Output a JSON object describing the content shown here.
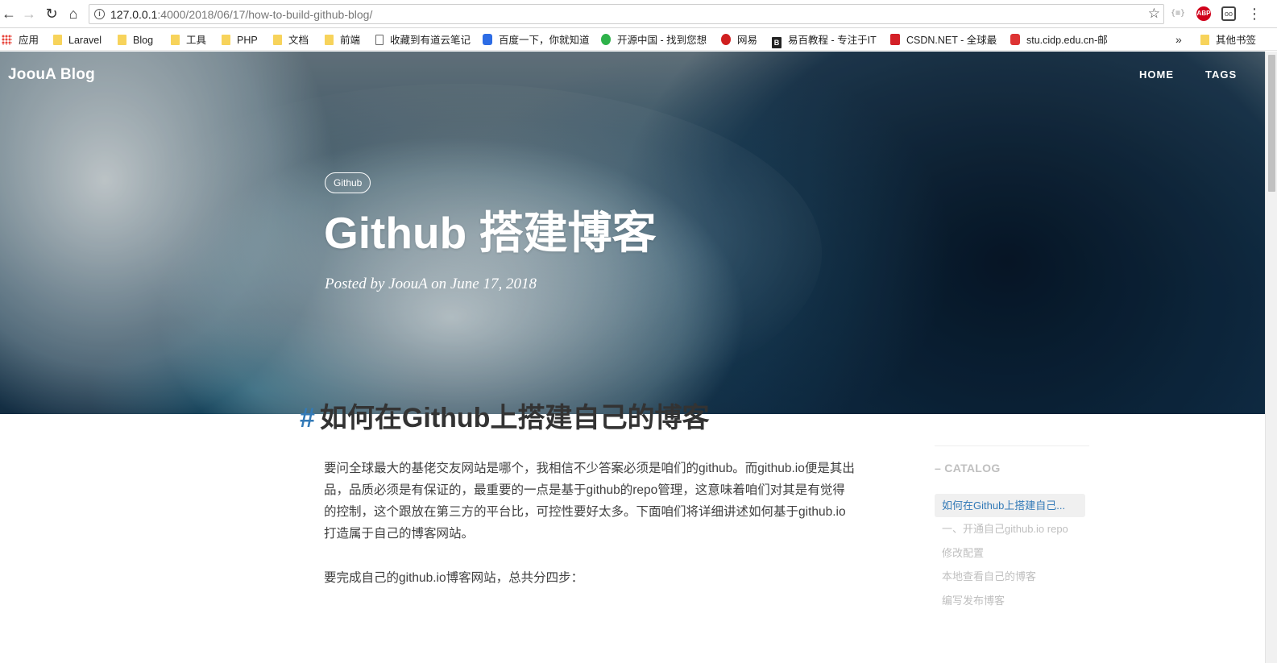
{
  "browser": {
    "url_host": "127.0.0.1",
    "url_rest": ":4000/2018/06/17/how-to-build-github-blog/",
    "extensions": [
      "{≡}",
      "ABP",
      "oo"
    ],
    "bookmarks": [
      {
        "label": "应用",
        "icon": "apps-grid-icon"
      },
      {
        "label": "Laravel",
        "icon": "folder-icon"
      },
      {
        "label": "Blog",
        "icon": "folder-icon"
      },
      {
        "label": "工具",
        "icon": "folder-icon"
      },
      {
        "label": "PHP",
        "icon": "folder-icon"
      },
      {
        "label": "文档",
        "icon": "folder-icon"
      },
      {
        "label": "前端",
        "icon": "folder-icon"
      },
      {
        "label": "收藏到有道云笔记",
        "icon": "page-icon"
      },
      {
        "label": "百度一下，你就知道",
        "icon": "baidu-icon"
      },
      {
        "label": "开源中国 - 找到您想",
        "icon": "oschina-icon"
      },
      {
        "label": "网易",
        "icon": "netease-icon"
      },
      {
        "label": "易百教程 - 专注于IT",
        "icon": "yiibai-icon",
        "glyph": "B"
      },
      {
        "label": "CSDN.NET - 全球最",
        "icon": "csdn-icon"
      },
      {
        "label": "stu.cidp.edu.cn-邮",
        "icon": "mail-icon"
      }
    ],
    "more_bookmarks": "»",
    "other_bookmarks": "其他书签"
  },
  "site": {
    "brand": "JoouA Blog",
    "nav": {
      "home": "HOME",
      "tags": "TAGS"
    }
  },
  "post": {
    "tag": "Github",
    "title": "Github 搭建博客",
    "meta": "Posted by JoouA on June 17, 2018"
  },
  "article": {
    "anchor": "#",
    "heading": "如何在Github上搭建自己的博客",
    "paragraphs": [
      "要问全球最大的基佬交友网站是哪个，我相信不少答案必须是咱们的github。而github.io便是其出品，品质必须是有保证的，最重要的一点是基于github的repo管理，这意味着咱们对其是有觉得的控制，这个跟放在第三方的平台比，可控性要好太多。下面咱们将详细讲述如何基于github.io打造属于自己的博客网站。",
      "要完成自己的github.io博客网站，总共分四步："
    ]
  },
  "catalog": {
    "title": "CATALOG",
    "items": [
      {
        "label": "如何在Github上搭建自己...",
        "active": true
      },
      {
        "label": "一、开通自己github.io repo",
        "active": false
      },
      {
        "label": "修改配置",
        "active": false
      },
      {
        "label": "本地查看自己的博客",
        "active": false
      },
      {
        "label": "编写发布博客",
        "active": false
      }
    ]
  }
}
